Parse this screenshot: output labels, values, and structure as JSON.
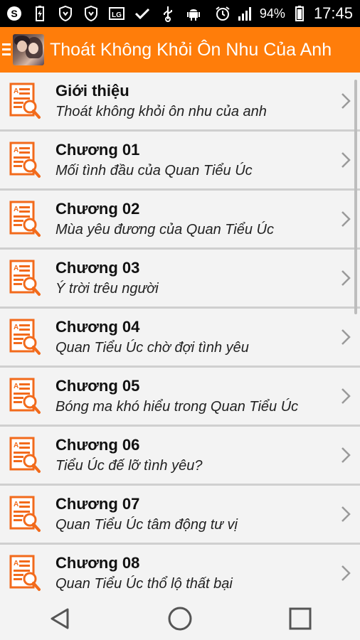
{
  "status_bar": {
    "battery_percent": "94%",
    "time": "17:45",
    "left_icons": [
      "skype-icon",
      "battery-charging-icon",
      "shield-icon",
      "shield-icon",
      "lg-icon",
      "check-icon",
      "usb-icon",
      "android-icon"
    ],
    "right_icons": [
      "alarm-icon",
      "signal-icon",
      "battery-icon"
    ]
  },
  "app_bar": {
    "title": "Thoát Không Khỏi Ôn Nhu Của Anh",
    "color": "#ff7d0a"
  },
  "chapters": [
    {
      "title": "Giới thiệu",
      "subtitle": "Thoát không khỏi ôn nhu của anh"
    },
    {
      "title": "Chương 01",
      "subtitle": "Mối tình đầu của Quan Tiểu Úc"
    },
    {
      "title": "Chương 02",
      "subtitle": "Mùa yêu đương của Quan Tiểu Úc"
    },
    {
      "title": "Chương 03",
      "subtitle": "Ý trời trêu người"
    },
    {
      "title": "Chương 04",
      "subtitle": "Quan Tiểu Úc chờ đợi tình yêu"
    },
    {
      "title": "Chương 05",
      "subtitle": "Bóng ma khó hiểu trong Quan Tiểu Úc"
    },
    {
      "title": "Chương 06",
      "subtitle": "Tiểu Úc đế lỡ tình yêu?"
    },
    {
      "title": "Chương 07",
      "subtitle": "Quan Tiểu Úc tâm động tư vị"
    },
    {
      "title": "Chương 08",
      "subtitle": "Quan Tiểu Úc thổ lộ thất bại"
    }
  ],
  "nav_bar": [
    "back-icon",
    "home-icon",
    "recents-icon"
  ]
}
